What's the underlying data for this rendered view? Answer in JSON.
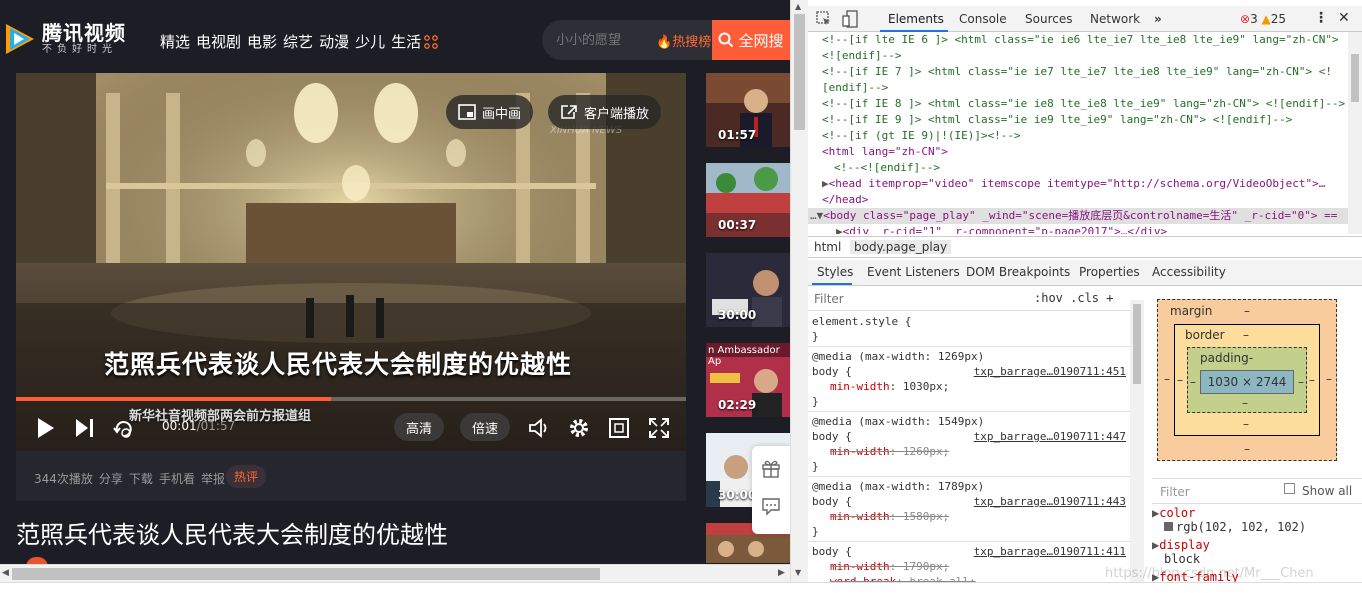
{
  "site": {
    "logo": {
      "name": "腾讯视频",
      "slogan": "不负好时光"
    },
    "nav": [
      "精选",
      "电视剧",
      "电影",
      "综艺",
      "动漫",
      "少儿",
      "生活"
    ],
    "search": {
      "placeholder": "小小的愿望",
      "hot_label": "热搜榜",
      "button_label": "全网搜"
    },
    "player": {
      "pip_label": "画中画",
      "client_label": "客户端播放",
      "caption": "范照兵代表谈人民代表大会制度的优越性",
      "subcaption": "新华社音视频部两会前方报道组",
      "watermark": "XINHUA NEWS",
      "time_current": "00:01",
      "time_total": "/01:57",
      "quality_label": "高清",
      "speed_label": "倍速",
      "progress": 0.47
    },
    "meta": [
      "344次播放",
      "分享",
      "下载",
      "手机看",
      "举报"
    ],
    "hot_comment_label": "热评",
    "video_title": "范照兵代表谈人民代表大会制度的优越性",
    "thumbs": [
      {
        "duration": "01:57"
      },
      {
        "duration": "00:37"
      },
      {
        "duration": "30:00"
      },
      {
        "duration": "02:29",
        "overlay": "n Ambassador Ap"
      },
      {
        "duration": "30:00"
      }
    ],
    "colors": {
      "accent": "#ff5c38",
      "bg": "#1d1d25"
    }
  },
  "devtools": {
    "tabs": [
      "Elements",
      "Console",
      "Sources",
      "Network"
    ],
    "errors": "3",
    "warnings": "25",
    "code_lines": [
      "<!--[if lte IE 6 ]> <html class=\"ie ie6 lte_ie7 lte_ie8 lte_ie9\" lang=\"zh-CN\">",
      "<![endif]-->",
      "<!--[if IE 7 ]> <html class=\"ie ie7 lte_ie7 lte_ie8 lte_ie9\" lang=\"zh-CN\"> <!",
      "[endif]-->",
      "<!--[if IE 8 ]> <html class=\"ie ie8 lte_ie8 lte_ie9\" lang=\"zh-CN\"> <![endif]-->",
      "<!--[if IE 9 ]> <html class=\"ie ie9 lte_ie9\" lang=\"zh-CN\"> <![endif]-->",
      "<!--[if (gt IE 9)|!(IE)]><!-->"
    ],
    "html_open": "<html lang=\"zh-CN\">",
    "endif_comment": "<!--<![endif]-->",
    "head_line": "<head itemprop=\"video\" itemscope itemtype=\"http://schema.org/VideoObject\">…",
    "head_close": "</head>",
    "body_line": "<body class=\"page_play\" _wind=\"scene=播放底层页&controlname=生活\" _r-cid=\"0\"> ==",
    "div_line": "<div _r-cid=\"1\" _r-component=\"p-page2017\">…</div>",
    "breadcrumb": [
      "html",
      "body.page_play"
    ],
    "style_tabs": [
      "Styles",
      "Event Listeners",
      "DOM Breakpoints",
      "Properties",
      "Accessibility"
    ],
    "filter_placeholder": "Filter",
    "hov_cls": ":hov  .cls  +",
    "rules": [
      {
        "selector": "element.style {",
        "src": "",
        "props": [],
        "close": "}"
      },
      {
        "media": "@media (max-width: 1269px)",
        "selector": "body {",
        "src": "txp_barrage…0190711:451",
        "props": [
          {
            "name": "min-width",
            "value": "1030px;",
            "struck": false
          }
        ],
        "close": "}"
      },
      {
        "media": "@media (max-width: 1549px)",
        "selector": "body {",
        "src": "txp_barrage…0190711:447",
        "props": [
          {
            "name": "min-width",
            "value": "1260px;",
            "struck": true
          }
        ],
        "close": "}"
      },
      {
        "media": "@media (max-width: 1789px)",
        "selector": "body {",
        "src": "txp_barrage…0190711:443",
        "props": [
          {
            "name": "min-width",
            "value": "1580px;",
            "struck": true
          }
        ],
        "close": "}"
      },
      {
        "media": "",
        "selector": "body {",
        "src": "txp_barrage…0190711:411",
        "props": [
          {
            "name": "min-width",
            "value": "1790px;",
            "struck": true
          },
          {
            "name": "word-break",
            "value": "break-all;",
            "struck": true
          }
        ],
        "close": ""
      }
    ],
    "boxmodel": {
      "margin": "margin",
      "border": "border",
      "padding": "padding-",
      "content": "1030 × 2744",
      "dash": "–"
    },
    "computed_filter": "Filter",
    "show_all": "Show all",
    "computed": [
      {
        "name": "color",
        "value": "rgb(102, 102, 102)"
      },
      {
        "name": "display",
        "value": "block"
      },
      {
        "name": "font-family",
        "value": ""
      }
    ],
    "watermark": "https://blog.csdn.net/Mr___Chen"
  }
}
